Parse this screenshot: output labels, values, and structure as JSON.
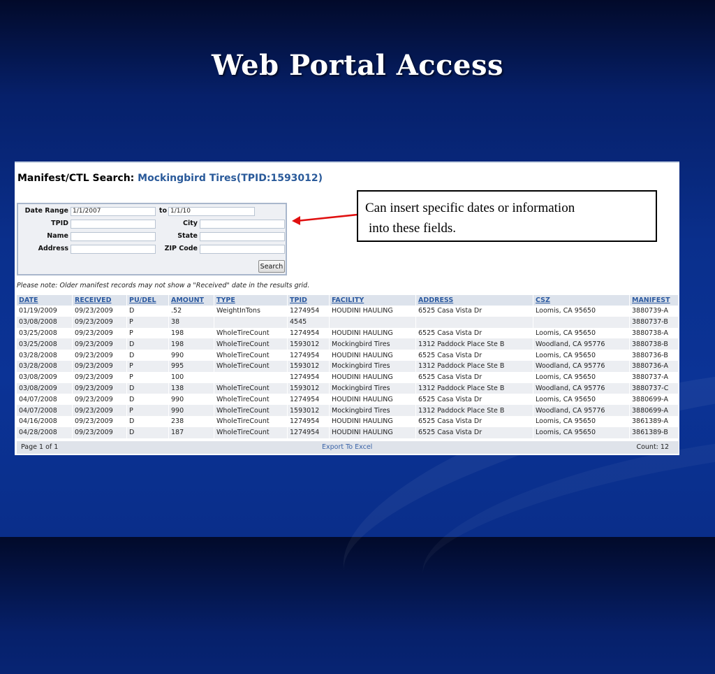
{
  "slide": {
    "title": "Web Portal Access"
  },
  "panel": {
    "heading_prefix": "Manifest/CTL Search:",
    "heading_company": "Mockingbird Tires(TPID:1593012)",
    "form": {
      "date_range_label": "Date Range",
      "date_from": "1/1/2007",
      "to_label": "to",
      "date_to": "1/1/10",
      "tpid_label": "TPID",
      "tpid_value": "",
      "city_label": "City",
      "city_value": "",
      "name_label": "Name",
      "name_value": "",
      "state_label": "State",
      "state_value": "",
      "address_label": "Address",
      "address_value": "",
      "zip_label": "ZIP Code",
      "zip_value": "",
      "search_label": "Search"
    },
    "note": "Please note: Older manifest records may not show a \"Received\" date in the results grid.",
    "columns": [
      "DATE",
      "RECEIVED",
      "PU/DEL",
      "AMOUNT",
      "TYPE",
      "TPID",
      "FACILITY",
      "ADDRESS",
      "CSZ",
      "MANIFEST"
    ],
    "rows": [
      [
        "01/19/2009",
        "09/23/2009",
        "D",
        ".52",
        "WeightInTons",
        "1274954",
        "HOUDINI HAULING",
        "6525 Casa Vista Dr",
        "Loomis, CA 95650",
        "3880739-A"
      ],
      [
        "03/08/2008",
        "09/23/2009",
        "P",
        "38",
        "",
        "4545",
        "",
        "",
        "",
        "3880737-B"
      ],
      [
        "03/25/2008",
        "09/23/2009",
        "P",
        "198",
        "WholeTireCount",
        "1274954",
        "HOUDINI HAULING",
        "6525 Casa Vista Dr",
        "Loomis, CA 95650",
        "3880738-A"
      ],
      [
        "03/25/2008",
        "09/23/2009",
        "D",
        "198",
        "WholeTireCount",
        "1593012",
        "Mockingbird Tires",
        "1312 Paddock Place Ste B",
        "Woodland, CA 95776",
        "3880738-B"
      ],
      [
        "03/28/2008",
        "09/23/2009",
        "D",
        "990",
        "WholeTireCount",
        "1274954",
        "HOUDINI HAULING",
        "6525 Casa Vista Dr",
        "Loomis, CA 95650",
        "3880736-B"
      ],
      [
        "03/28/2008",
        "09/23/2009",
        "P",
        "995",
        "WholeTireCount",
        "1593012",
        "Mockingbird Tires",
        "1312 Paddock Place Ste B",
        "Woodland, CA 95776",
        "3880736-A"
      ],
      [
        "03/08/2009",
        "09/23/2009",
        "P",
        "100",
        "",
        "1274954",
        "HOUDINI HAULING",
        "6525 Casa Vista Dr",
        "Loomis, CA 95650",
        "3880737-A"
      ],
      [
        "03/08/2009",
        "09/23/2009",
        "D",
        "138",
        "WholeTireCount",
        "1593012",
        "Mockingbird Tires",
        "1312 Paddock Place Ste B",
        "Woodland, CA 95776",
        "3880737-C"
      ],
      [
        "04/07/2008",
        "09/23/2009",
        "D",
        "990",
        "WholeTireCount",
        "1274954",
        "HOUDINI HAULING",
        "6525 Casa Vista Dr",
        "Loomis, CA 95650",
        "3880699-A"
      ],
      [
        "04/07/2008",
        "09/23/2009",
        "P",
        "990",
        "WholeTireCount",
        "1593012",
        "Mockingbird Tires",
        "1312 Paddock Place Ste B",
        "Woodland, CA 95776",
        "3880699-A"
      ],
      [
        "04/16/2008",
        "09/23/2009",
        "D",
        "238",
        "WholeTireCount",
        "1274954",
        "HOUDINI HAULING",
        "6525 Casa Vista Dr",
        "Loomis, CA 95650",
        "3861389-A"
      ],
      [
        "04/28/2008",
        "09/23/2009",
        "D",
        "187",
        "WholeTireCount",
        "1274954",
        "HOUDINI HAULING",
        "6525 Casa Vista Dr",
        "Loomis, CA 95650",
        "3861389-B"
      ]
    ],
    "footer": {
      "page": "Page 1 of 1",
      "export": "Export To Excel",
      "count": "Count: 12"
    }
  },
  "callout": {
    "line1": "Can insert specific dates or information",
    "line2": "into these fields."
  },
  "colors": {
    "arrow": "#e01010",
    "link": "#2c5aa0",
    "background": "#0a2f8c"
  }
}
